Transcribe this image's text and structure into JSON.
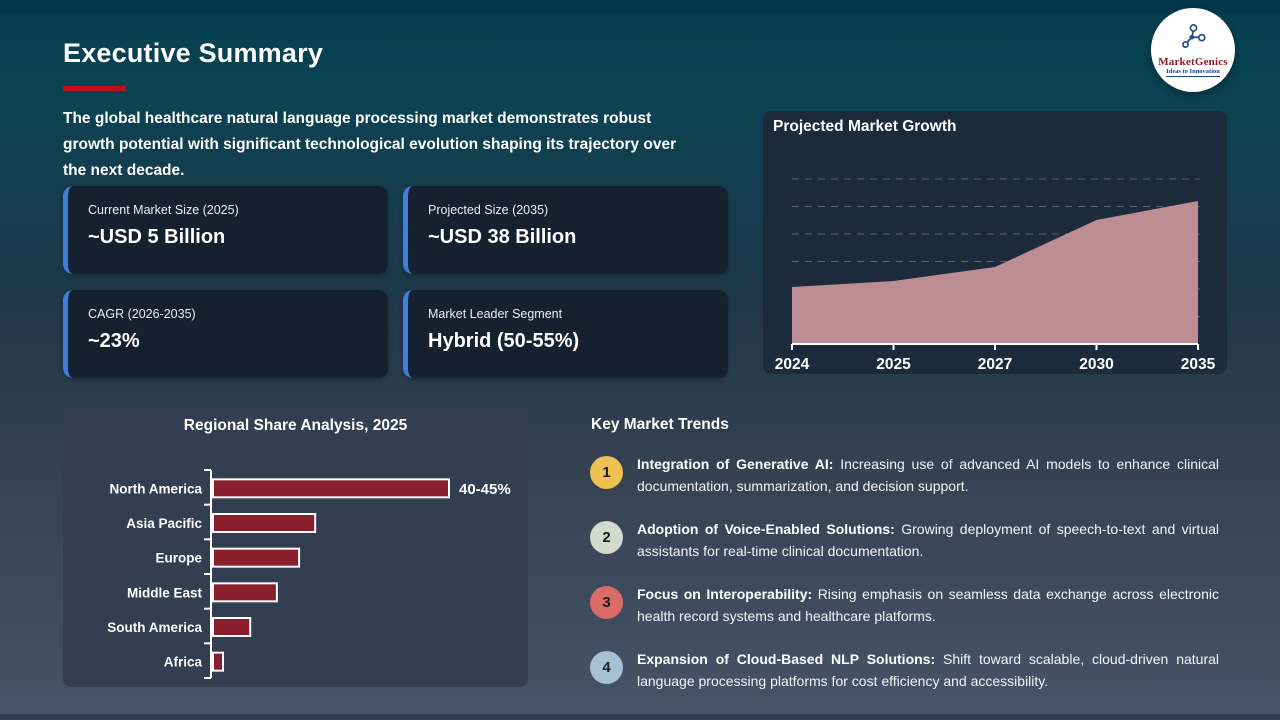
{
  "page": {
    "title": "Executive Summary",
    "intro": "The global healthcare natural language processing market demonstrates robust growth potential with significant technological evolution shaping its trajectory over the next decade."
  },
  "logo": {
    "name": "MarketGenics",
    "tagline": "Ideas to Innovation"
  },
  "stat_cards": [
    {
      "label": "Current Market Size (2025)",
      "value": "~USD 5 Billion"
    },
    {
      "label": "Projected Size (2035)",
      "value": "~USD 38 Billion"
    },
    {
      "label": "CAGR (2026-2035)",
      "value": "~23%"
    },
    {
      "label": "Market Leader Segment",
      "value": "Hybrid (50-55%)"
    }
  ],
  "chart_data": [
    {
      "type": "area",
      "title": "Projected Market Growth",
      "x": [
        "2024",
        "2025",
        "2027",
        "2030",
        "2035"
      ],
      "values": [
        57,
        63,
        77,
        124,
        143
      ],
      "units": "relative height (stylized chart, no y-axis labels shown)",
      "ylim": [
        0,
        165
      ],
      "grid": "dashed horizontal gridlines",
      "gridline_count": 6,
      "area_color": "#c49298",
      "axis_color": "#ffffff"
    },
    {
      "type": "bar",
      "orientation": "horizontal",
      "title": "Regional Share Analysis, 2025",
      "categories": [
        "North America",
        "Asia Pacific",
        "Europe",
        "Middle East",
        "South America",
        "Africa"
      ],
      "values": [
        42.5,
        18.4,
        15.5,
        11.5,
        6.7,
        1.8
      ],
      "units": "% market share (estimated from bar lengths; only North America labeled on chart)",
      "data_labels": [
        "40-45%",
        "",
        "",
        "",
        "",
        ""
      ],
      "xlim": [
        0,
        44.5
      ],
      "bar_color": "#8b1e2c",
      "bar_border_color": "#ffffff",
      "axis_color": "#ffffff"
    }
  ],
  "trends": {
    "heading": "Key Market Trends",
    "items": [
      {
        "num": "1",
        "badge_color": "#eec153",
        "bold": "Integration of Generative AI:",
        "text": " Increasing use of advanced AI models to enhance clinical documentation, summarization, and decision support."
      },
      {
        "num": "2",
        "badge_color": "#d3d9cd",
        "bold": "Adoption of Voice-Enabled Solutions:",
        "text": " Growing deployment of speech-to-text and virtual assistants for real-time clinical documentation."
      },
      {
        "num": "3",
        "badge_color": "#da6b67",
        "bold": "Focus on Interoperability:",
        "text": " Rising emphasis on seamless data exchange across electronic health record systems and healthcare platforms."
      },
      {
        "num": "4",
        "badge_color": "#a6c0d4",
        "bold": "Expansion of Cloud-Based NLP Solutions:",
        "text": " Shift toward scalable, cloud-driven natural language processing platforms for cost efficiency and accessibility."
      }
    ]
  },
  "colors": {
    "accent_blue": "#3f7ede",
    "rule_red": "#c00d18",
    "card_dark": "#15212e",
    "growth_card_bg": "#1b2b3b",
    "regional_card_bg": "#333e50",
    "background_top": "#05404f",
    "background_bottom": "#475469"
  }
}
